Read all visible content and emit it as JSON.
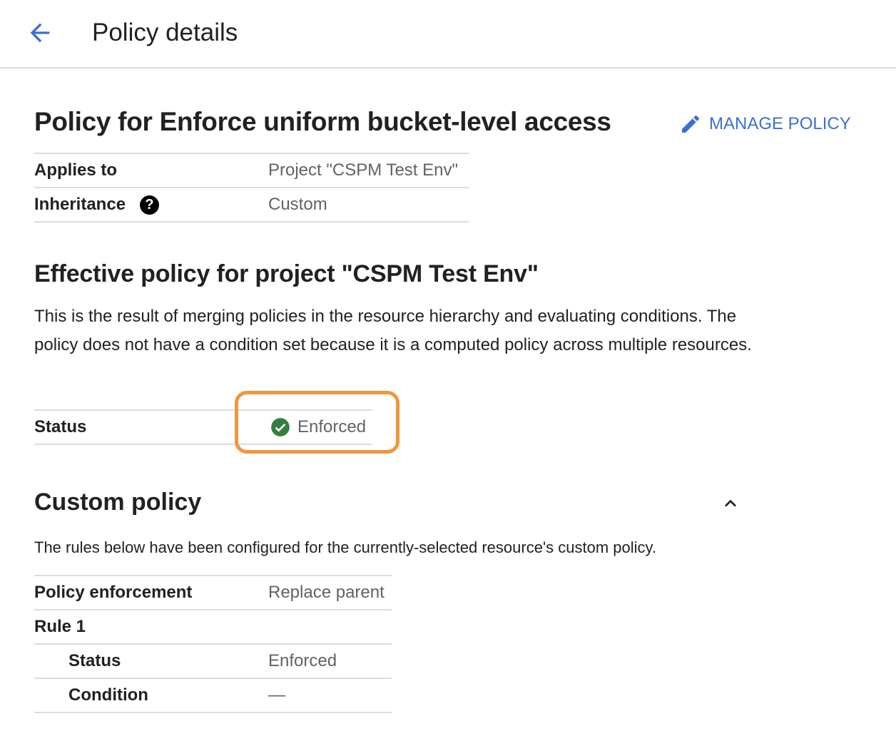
{
  "header": {
    "title": "Policy details",
    "back_icon": "arrow-back-icon"
  },
  "policy": {
    "title": "Policy for Enforce uniform bucket-level access",
    "manage_label": "MANAGE POLICY",
    "details": [
      {
        "label": "Applies to",
        "value": "Project \"CSPM Test Env\""
      },
      {
        "label": "Inheritance",
        "value": "Custom",
        "help": "?"
      }
    ]
  },
  "effective": {
    "title": "Effective policy for project \"CSPM Test Env\"",
    "description": "This is the result of merging policies in the resource hierarchy and evaluating conditions. The policy does not have a condition set because it is a computed policy across multiple resources.",
    "status_label": "Status",
    "status_value": "Enforced",
    "colors": {
      "success": "#34803f",
      "highlight": "#f0963a"
    }
  },
  "custom": {
    "title": "Custom policy",
    "description": "The rules below have been configured for the currently-selected resource's custom policy.",
    "rows": [
      {
        "label": "Policy enforcement",
        "value": "Replace parent"
      },
      {
        "label": "Rule 1",
        "value": ""
      },
      {
        "label": "Status",
        "value": "Enforced"
      },
      {
        "label": "Condition",
        "value": "—"
      }
    ]
  }
}
